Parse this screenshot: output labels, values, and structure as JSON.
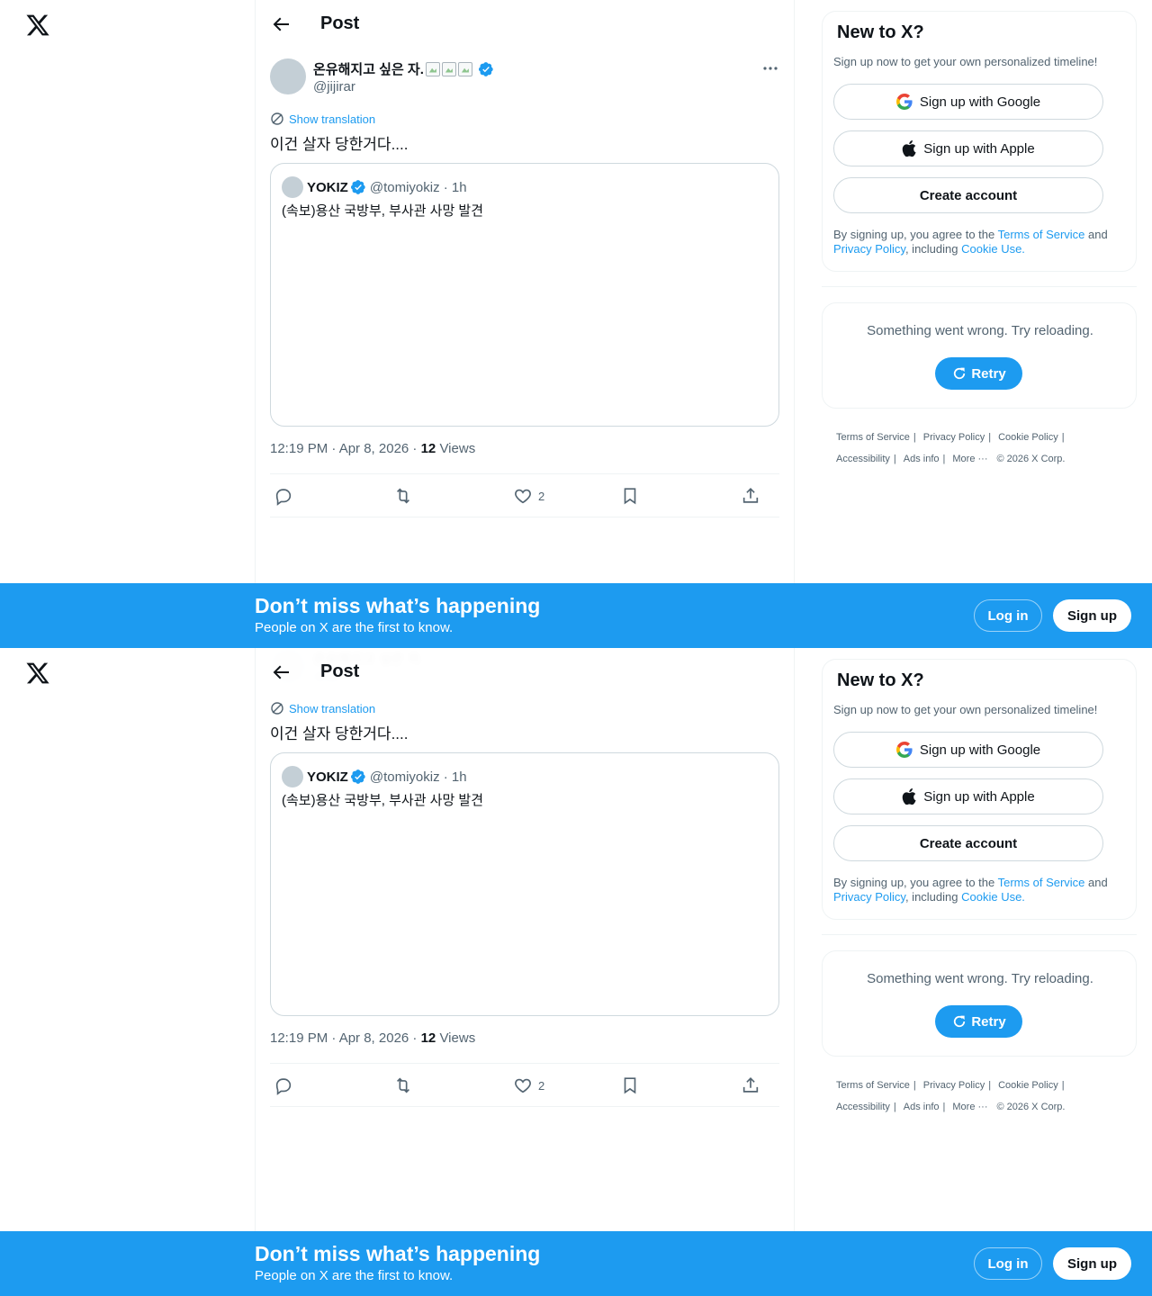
{
  "brand": {
    "accent": "#1d9bf0",
    "logo_icon": "x-logo-icon"
  },
  "header": {
    "title": "Post"
  },
  "post": {
    "author_name": "온유해지고 싶은 자.",
    "author_handle": "@jijirar",
    "show_translation": "Show translation",
    "text": "이건 살자 당한거다....",
    "timestamp": "12:19 PM · Apr 8, 2026 · ",
    "views_count": "12",
    "views_label": " Views",
    "likes": "2"
  },
  "quote": {
    "name": "YOKIZ",
    "handle_time": "@tomiyokiz · 1h",
    "text": "(속보)용산 국방부, 부사관 사망 발견"
  },
  "signup_card": {
    "title": "New to X?",
    "subtitle": "Sign up now to get your own personalized timeline!",
    "google": "Sign up with Google",
    "apple": "Sign up with Apple",
    "create": "Create account",
    "legal_prefix": "By signing up, you agree to the ",
    "terms": "Terms of Service",
    "and": " and ",
    "privacy": "Privacy Policy",
    "including": ", including ",
    "cookie": "Cookie Use."
  },
  "error_card": {
    "message": "Something went wrong. Try reloading.",
    "retry": "Retry"
  },
  "footer": {
    "terms": "Terms of Service",
    "privacy": "Privacy Policy",
    "cookie": "Cookie Policy",
    "accessibility": "Accessibility",
    "ads": "Ads info",
    "more": "More ···",
    "copyright": "© 2026 X Corp."
  },
  "banner": {
    "title": "Don’t miss what’s happening",
    "subtitle": "People on X are the first to know.",
    "login": "Log in",
    "signup": "Sign up"
  }
}
